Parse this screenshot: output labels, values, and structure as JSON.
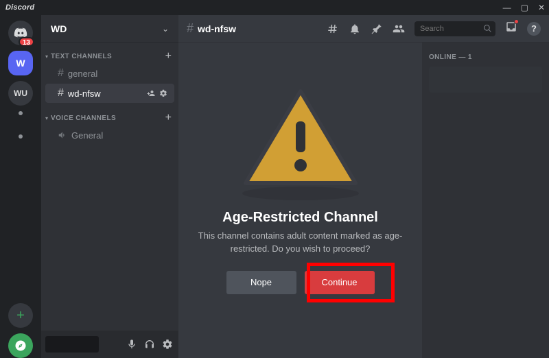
{
  "titlebar": {
    "brand": "Discord"
  },
  "servers": {
    "home_badge": "13",
    "current_initial": "W",
    "second_initials": "WU",
    "add_label": "+"
  },
  "sidebar": {
    "server_name": "WD",
    "categories": [
      {
        "name": "TEXT CHANNELS",
        "channels": [
          {
            "label": "general",
            "type": "text",
            "active": false
          },
          {
            "label": "wd-nfsw",
            "type": "text",
            "active": true
          }
        ]
      },
      {
        "name": "VOICE CHANNELS",
        "channels": [
          {
            "label": "General",
            "type": "voice",
            "active": false
          }
        ]
      }
    ]
  },
  "header": {
    "channel_name": "wd-nfsw",
    "search_placeholder": "Search"
  },
  "gate": {
    "title": "Age-Restricted Channel",
    "description": "This channel contains adult content marked as age-restricted. Do you wish to proceed?",
    "nope_label": "Nope",
    "continue_label": "Continue"
  },
  "members": {
    "online_label": "ONLINE — 1"
  }
}
